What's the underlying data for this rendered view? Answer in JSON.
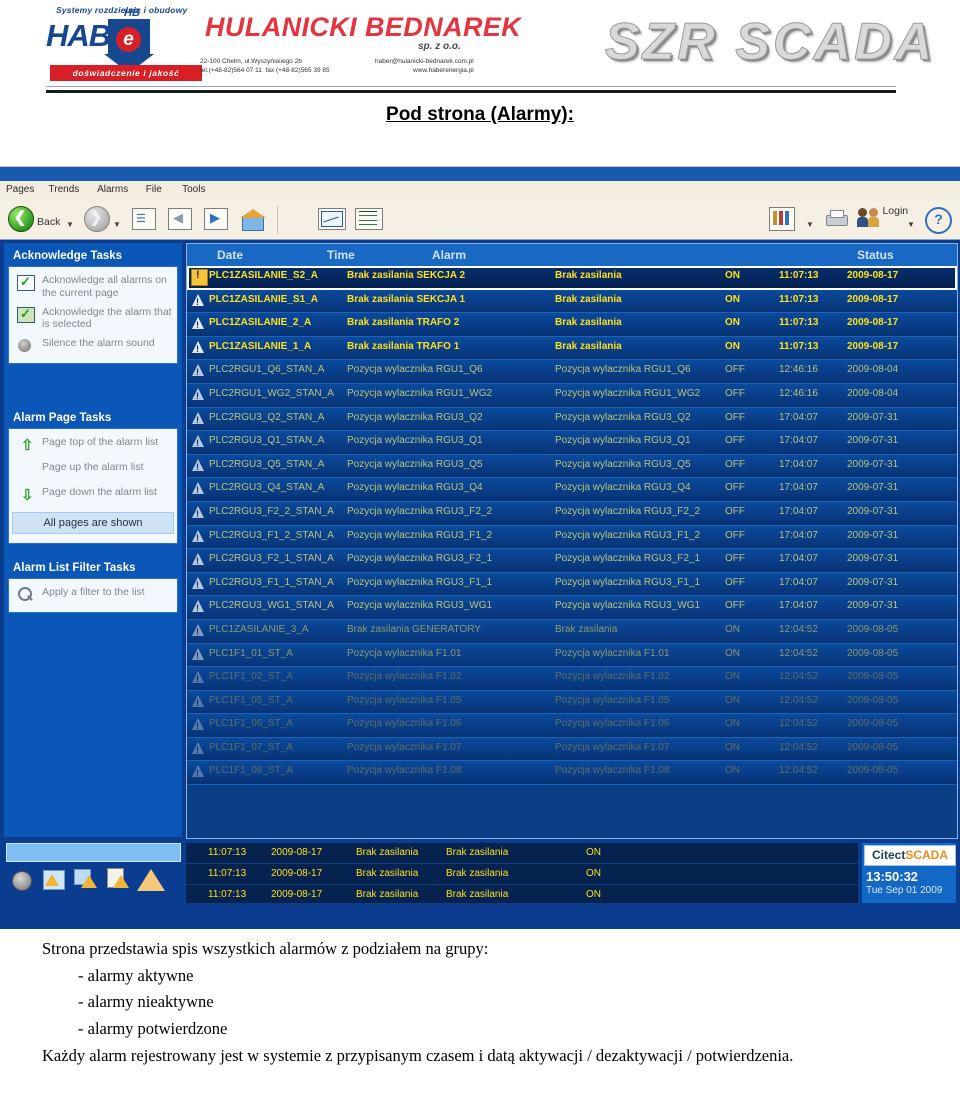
{
  "letterhead": {
    "tagline_top": "Systemy rozdzielnic i obudowy",
    "logo_word": "HAB R",
    "logo_hb": "HB",
    "logo_e": "e",
    "logo_bar": "doświadczenie  i  jakość",
    "company": "HULANICKI BEDNAREK",
    "company_sub": "sp. z o.o.",
    "address": "22-100 Chełm, ul.Wyszyńskiego 2b\ntel.(+48-82)564 07 11  fax (+48-82)565 39 85",
    "contact": "haber@hulanicki-bednarek.com.pl\nwww.haberenergia.pl",
    "product_logo": "SZR SCADA"
  },
  "doc_title": "Pod strona (Alarmy):",
  "scada": {
    "menu": [
      "Pages",
      "Trends",
      "Alarms",
      "File",
      "Tools"
    ],
    "toolbar": {
      "back_label": "Back",
      "login_label": "Login",
      "icons": [
        "back-arrow-icon",
        "forward-arrow-icon",
        "page-list-icon",
        "page-previous-icon",
        "page-next-icon",
        "home-icon",
        "trend-page-icon",
        "trend-chart-icon",
        "report-icon",
        "print-icon",
        "login-users-icon",
        "help-icon"
      ]
    },
    "sidebar": {
      "sections": [
        {
          "title": "Acknowledge Tasks",
          "tasks": [
            {
              "label": "Acknowledge all alarms on the current page",
              "icon": "checkbox-ack-all-icon"
            },
            {
              "label": "Acknowledge the alarm that is selected",
              "icon": "checkbox-ack-selected-icon"
            },
            {
              "label": "Silence the alarm sound",
              "icon": "speaker-mute-icon"
            }
          ]
        },
        {
          "title": "Alarm Page Tasks",
          "tasks": [
            {
              "label": "Page top of the alarm list",
              "icon": "arrow-up-green-icon"
            },
            {
              "label": "Page up the alarm list",
              "icon": "none"
            },
            {
              "label": "Page down the alarm list",
              "icon": "arrow-down-green-icon"
            }
          ],
          "status": "All pages are shown"
        },
        {
          "title": "Alarm List Filter Tasks",
          "tasks": [
            {
              "label": "Apply a filter to the list",
              "icon": "magnifier-filter-icon"
            }
          ]
        }
      ]
    },
    "table": {
      "headers": [
        "Date",
        "Time",
        "Alarm",
        "Status"
      ],
      "rows": [
        {
          "tag": "PLC1ZASILANIE_S2_A",
          "desc": "Brak zasilania SEKCJA 2",
          "desc2": "Brak zasilania",
          "state": "ON",
          "time": "11:07:13",
          "date": "2009-08-17",
          "level": 0,
          "selected": true
        },
        {
          "tag": "PLC1ZASILANIE_S1_A",
          "desc": "Brak zasilania SEKCJA 1",
          "desc2": "Brak zasilania",
          "state": "ON",
          "time": "11:07:13",
          "date": "2009-08-17",
          "level": 0,
          "selected": false
        },
        {
          "tag": "PLC1ZASILANIE_2_A",
          "desc": "Brak zasilania TRAFO 2",
          "desc2": "Brak zasilania",
          "state": "ON",
          "time": "11:07:13",
          "date": "2009-08-17",
          "level": 0,
          "selected": false
        },
        {
          "tag": "PLC1ZASILANIE_1_A",
          "desc": "Brak zasilania TRAFO 1",
          "desc2": "Brak zasilania",
          "state": "ON",
          "time": "11:07:13",
          "date": "2009-08-17",
          "level": 0,
          "selected": false
        },
        {
          "tag": "PLC2RGU1_Q6_STAN_A",
          "desc": "Pozycja wylacznika RGU1_Q6",
          "desc2": "Pozycja wylacznika RGU1_Q6",
          "state": "OFF",
          "time": "12:46:16",
          "date": "2009-08-04",
          "level": 1,
          "selected": false
        },
        {
          "tag": "PLC2RGU1_WG2_STAN_A",
          "desc": "Pozycja wylacznika RGU1_WG2",
          "desc2": "Pozycja wylacznika RGU1_WG2",
          "state": "OFF",
          "time": "12:46:16",
          "date": "2009-08-04",
          "level": 1,
          "selected": false
        },
        {
          "tag": "PLC2RGU3_Q2_STAN_A",
          "desc": "Pozycja wylacznika RGU3_Q2",
          "desc2": "Pozycja wylacznika RGU3_Q2",
          "state": "OFF",
          "time": "17:04:07",
          "date": "2009-07-31",
          "level": 1,
          "selected": false
        },
        {
          "tag": "PLC2RGU3_Q1_STAN_A",
          "desc": "Pozycja wylacznika RGU3_Q1",
          "desc2": "Pozycja wylacznika RGU3_Q1",
          "state": "OFF",
          "time": "17:04:07",
          "date": "2009-07-31",
          "level": 1,
          "selected": false
        },
        {
          "tag": "PLC2RGU3_Q5_STAN_A",
          "desc": "Pozycja wylacznika RGU3_Q5",
          "desc2": "Pozycja wylacznika RGU3_Q5",
          "state": "OFF",
          "time": "17:04:07",
          "date": "2009-07-31",
          "level": 1,
          "selected": false
        },
        {
          "tag": "PLC2RGU3_Q4_STAN_A",
          "desc": "Pozycja wylacznika RGU3_Q4",
          "desc2": "Pozycja wylacznika RGU3_Q4",
          "state": "OFF",
          "time": "17:04:07",
          "date": "2009-07-31",
          "level": 1,
          "selected": false
        },
        {
          "tag": "PLC2RGU3_F2_2_STAN_A",
          "desc": "Pozycja wylacznika RGU3_F2_2",
          "desc2": "Pozycja wylacznika RGU3_F2_2",
          "state": "OFF",
          "time": "17:04:07",
          "date": "2009-07-31",
          "level": 1,
          "selected": false
        },
        {
          "tag": "PLC2RGU3_F1_2_STAN_A",
          "desc": "Pozycja wylacznika RGU3_F1_2",
          "desc2": "Pozycja wylacznika RGU3_F1_2",
          "state": "OFF",
          "time": "17:04:07",
          "date": "2009-07-31",
          "level": 1,
          "selected": false
        },
        {
          "tag": "PLC2RGU3_F2_1_STAN_A",
          "desc": "Pozycja wylacznika RGU3_F2_1",
          "desc2": "Pozycja wylacznika RGU3_F2_1",
          "state": "OFF",
          "time": "17:04:07",
          "date": "2009-07-31",
          "level": 1,
          "selected": false
        },
        {
          "tag": "PLC2RGU3_F1_1_STAN_A",
          "desc": "Pozycja wylacznika RGU3_F1_1",
          "desc2": "Pozycja wylacznika RGU3_F1_1",
          "state": "OFF",
          "time": "17:04:07",
          "date": "2009-07-31",
          "level": 1,
          "selected": false
        },
        {
          "tag": "PLC2RGU3_WG1_STAN_A",
          "desc": "Pozycja wylacznika RGU3_WG1",
          "desc2": "Pozycja wylacznika RGU3_WG1",
          "state": "OFF",
          "time": "17:04:07",
          "date": "2009-07-31",
          "level": 1,
          "selected": false
        },
        {
          "tag": "PLC1ZASILANIE_3_A",
          "desc": "Brak zasilania GENERATORY",
          "desc2": "Brak zasilania",
          "state": "ON",
          "time": "12:04:52",
          "date": "2009-08-05",
          "level": 2,
          "selected": false
        },
        {
          "tag": "PLC1F1_01_ST_A",
          "desc": "Pozycja wylacznika F1.01",
          "desc2": "Pozycja wylacznika F1.01",
          "state": "ON",
          "time": "12:04:52",
          "date": "2009-08-05",
          "level": 2,
          "selected": false
        },
        {
          "tag": "PLC1F1_02_ST_A",
          "desc": "Pozycja wylacznika F1.02",
          "desc2": "Pozycja wylacznika F1.02",
          "state": "ON",
          "time": "12:04:52",
          "date": "2009-08-05",
          "level": 3,
          "selected": false
        },
        {
          "tag": "PLC1F1_05_ST_A",
          "desc": "Pozycja wylacznika F1.05",
          "desc2": "Pozycja wylacznika F1.05",
          "state": "ON",
          "time": "12:04:52",
          "date": "2009-08-05",
          "level": 3,
          "selected": false
        },
        {
          "tag": "PLC1F1_06_ST_A",
          "desc": "Pozycja wylacznika F1.06",
          "desc2": "Pozycja wylacznika F1.06",
          "state": "ON",
          "time": "12:04:52",
          "date": "2009-08-05",
          "level": 3,
          "selected": false
        },
        {
          "tag": "PLC1F1_07_ST_A",
          "desc": "Pozycja wylacznika F1.07",
          "desc2": "Pozycja wylacznika F1.07",
          "state": "ON",
          "time": "12:04:52",
          "date": "2009-08-05",
          "level": 3,
          "selected": false
        },
        {
          "tag": "PLC1F1_08_ST_A",
          "desc": "Pozycja wylacznika F1.08",
          "desc2": "Pozycja wylacznika F1.08",
          "state": "ON",
          "time": "12:04:52",
          "date": "2009-08-05",
          "level": 3,
          "selected": false
        }
      ]
    },
    "statusbar": {
      "rows": [
        {
          "time": "11:07:13",
          "date": "2009-08-17",
          "d1": "Brak zasilania",
          "d2": "Brak zasilania",
          "state": "ON"
        },
        {
          "time": "11:07:13",
          "date": "2009-08-17",
          "d1": "Brak zasilania",
          "d2": "Brak zasilania",
          "state": "ON"
        },
        {
          "time": "11:07:13",
          "date": "2009-08-17",
          "d1": "Brak zasilania",
          "d2": "Brak zasilania",
          "state": "ON"
        }
      ],
      "tray_icons": [
        "speaker-icon",
        "alarm-summary-icon",
        "alarm-disabled-icon",
        "alarm-log-icon",
        "alarm-warning-icon"
      ],
      "brand_1": "Citect",
      "brand_2": "SCADA",
      "clock": "13:50:32",
      "clock_date": "Tue Sep 01 2009"
    }
  },
  "description": {
    "line1": "Strona przedstawia spis wszystkich alarmów z podziałem na grupy:",
    "bullet1": "- alarmy aktywne",
    "bullet2": "- alarmy nieaktywne",
    "bullet3": "- alarmy potwierdzone",
    "line2": "Każdy alarm  rejestrowany jest w systemie z przypisanym czasem  i datą aktywacji / dezaktywacji / potwierdzenia."
  },
  "colors": {
    "brand_red": "#e4343f",
    "brand_blue": "#17488f",
    "scada_blue": "#0a3d8f",
    "alarm_yellow": "#ffe11a",
    "citect_orange": "#f08b1d"
  }
}
